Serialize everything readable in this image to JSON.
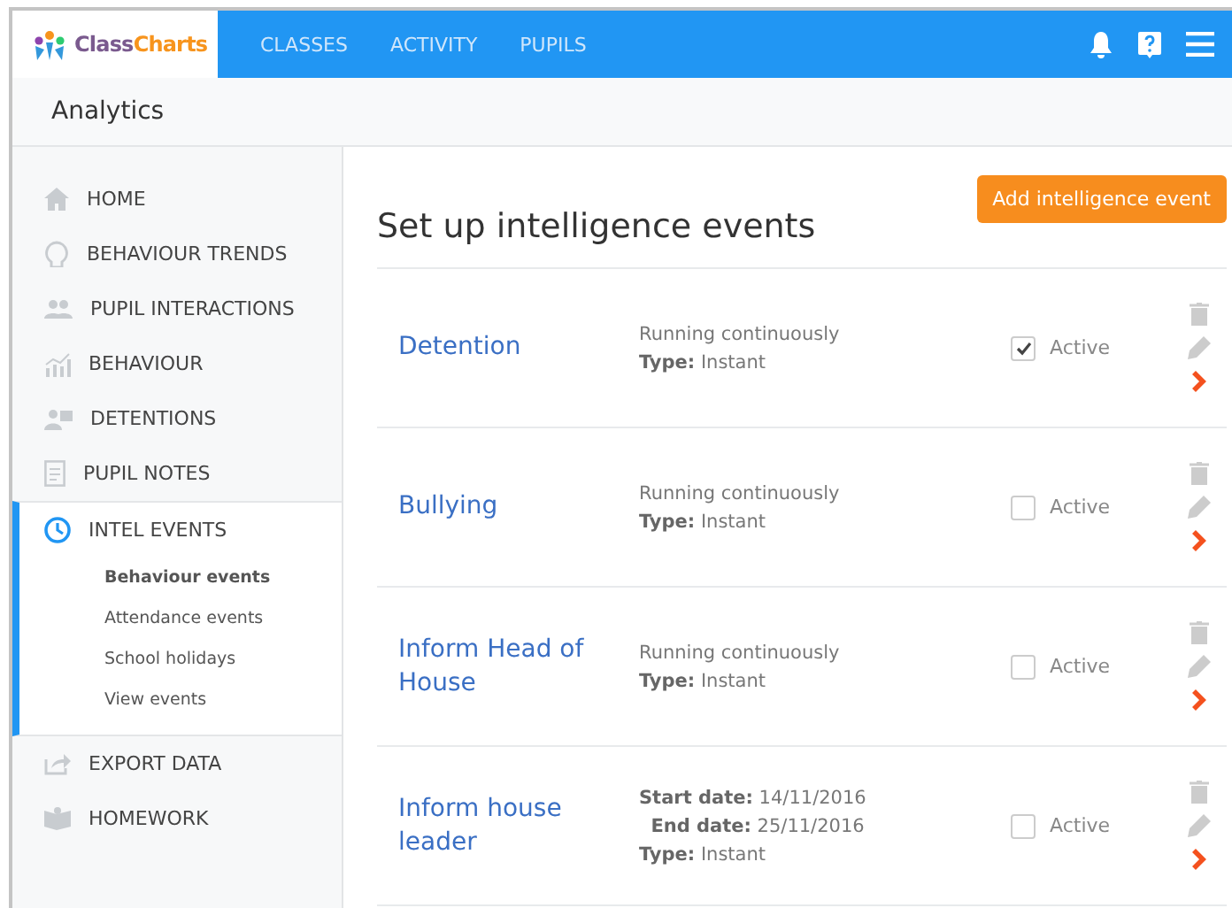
{
  "logo": {
    "parts": [
      "Class",
      "Charts"
    ]
  },
  "nav": [
    {
      "label": "CLASSES"
    },
    {
      "label": "ACTIVITY"
    },
    {
      "label": "PUPILS"
    }
  ],
  "page_title": "Analytics",
  "sidebar": {
    "items": [
      {
        "kind": "home",
        "label": "HOME",
        "selected": false
      },
      {
        "kind": "head",
        "label": "BEHAVIOUR TRENDS",
        "selected": false
      },
      {
        "kind": "people",
        "label": "PUPIL INTERACTIONS",
        "selected": false
      },
      {
        "kind": "chart",
        "label": "BEHAVIOUR",
        "selected": false
      },
      {
        "kind": "detention",
        "label": "DETENTIONS",
        "selected": false
      },
      {
        "kind": "note",
        "label": "PUPIL NOTES",
        "selected": false
      },
      {
        "kind": "clock",
        "label": "INTEL EVENTS",
        "selected": true,
        "children": [
          {
            "label": "Behaviour events",
            "selected": true
          },
          {
            "label": "Attendance events",
            "selected": false
          },
          {
            "label": "School holidays",
            "selected": false
          },
          {
            "label": "View events",
            "selected": false
          }
        ]
      },
      {
        "kind": "export",
        "label": "EXPORT DATA",
        "selected": false
      },
      {
        "kind": "book",
        "label": "HOMEWORK",
        "selected": false
      }
    ]
  },
  "main": {
    "title": "Set up intelligence events",
    "add_button": "Add intelligence event",
    "events": [
      {
        "name": "Detention",
        "details": [
          "Running continuously",
          "**Type:** Instant"
        ],
        "active": true,
        "active_label": "Active"
      },
      {
        "name": "Bullying",
        "details": [
          "Running continuously",
          "**Type:** Instant"
        ],
        "active": false,
        "active_label": "Active"
      },
      {
        "name": "Inform Head of House",
        "details": [
          "Running continuously",
          "**Type:** Instant"
        ],
        "active": false,
        "active_label": "Active"
      },
      {
        "name": "Inform house leader",
        "details": [
          "**Start date:** 14/11/2016",
          "  **End date:** 25/11/2016",
          "**Type:** Instant"
        ],
        "active": false,
        "active_label": "Active"
      }
    ]
  }
}
